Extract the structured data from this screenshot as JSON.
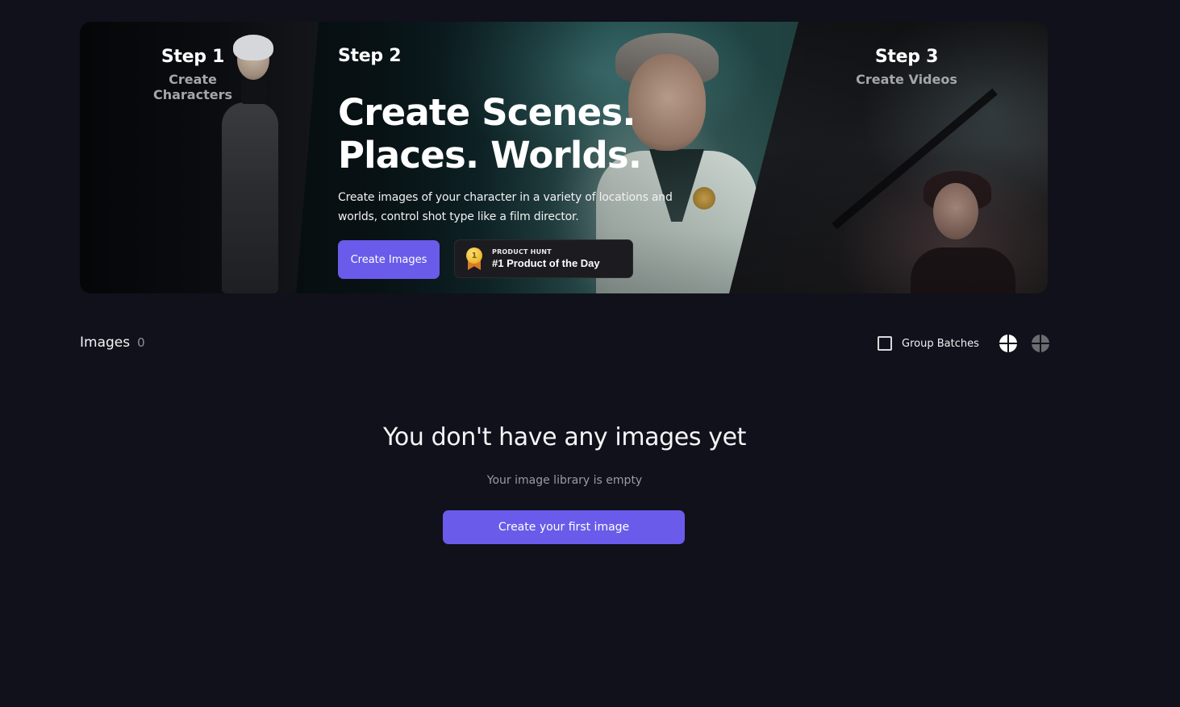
{
  "hero": {
    "step1": {
      "title": "Step 1",
      "subtitle": "Create Characters"
    },
    "step2": {
      "title": "Step 2"
    },
    "step3": {
      "title": "Step 3",
      "subtitle": "Create Videos"
    },
    "heading_line1": "Create Scenes.",
    "heading_line2": "Places. Worlds.",
    "description": "Create images of your character in a variety of locations and worlds, control shot type like a film director.",
    "cta_label": "Create Images",
    "product_hunt": {
      "small_label": "PRODUCT HUNT",
      "big_label": "#1 Product of the Day",
      "medal_number": "1",
      "icon": "medal-icon"
    }
  },
  "images_section": {
    "title": "Images",
    "count": "0",
    "group_batches_label": "Group Batches",
    "group_batches_checked": false,
    "view_icons": [
      "grid-large-view-icon",
      "grid-small-view-icon"
    ]
  },
  "empty_state": {
    "title": "You don't have any images yet",
    "subtitle": "Your image library is empty",
    "button_label": "Create your first image"
  },
  "colors": {
    "background": "#11111b",
    "accent": "#6a5bea",
    "muted_text": "#9a9ba2"
  }
}
